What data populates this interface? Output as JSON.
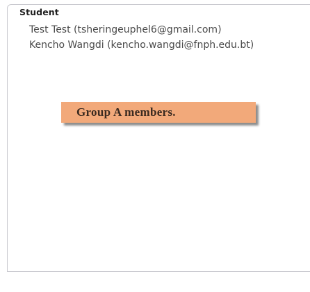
{
  "panel": {
    "section_title": "Student",
    "members": [
      "Test Test (tsheringeuphel6@gmail.com)",
      "Kencho Wangdi (kencho.wangdi@fnph.edu.bt)"
    ]
  },
  "callout": {
    "text": "Group A members."
  },
  "colors": {
    "callout_background": "#f2a97a",
    "panel_border": "#c9c9cf",
    "member_text": "#4a4a4a"
  }
}
